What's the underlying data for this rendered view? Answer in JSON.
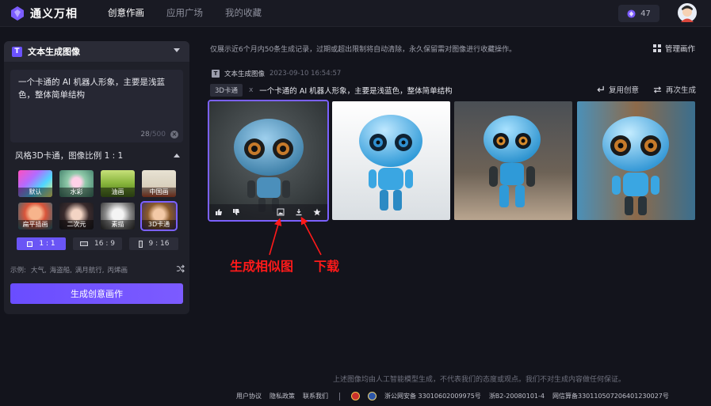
{
  "app": {
    "name": "通义万相",
    "points": "47"
  },
  "nav": {
    "items": [
      {
        "label": "创意作画",
        "active": true
      },
      {
        "label": "应用广场",
        "active": false
      },
      {
        "label": "我的收藏",
        "active": false
      }
    ]
  },
  "panel": {
    "title": "文本生成图像",
    "prompt": "一个卡通的 AI 机器人形象，主要是浅蓝色，整体简单结构",
    "char_count": "28",
    "char_max": "/500",
    "style_summary": "风格3D卡通，图像比例 1 : 1",
    "styles": [
      {
        "label": "默认",
        "selected": false
      },
      {
        "label": "水彩",
        "selected": false
      },
      {
        "label": "油画",
        "selected": false
      },
      {
        "label": "中国画",
        "selected": false
      },
      {
        "label": "扁平插画",
        "selected": false
      },
      {
        "label": "二次元",
        "selected": false
      },
      {
        "label": "素描",
        "selected": false
      },
      {
        "label": "3D卡通",
        "selected": true
      }
    ],
    "ratios": [
      {
        "label": "1 : 1",
        "active": true
      },
      {
        "label": "16 : 9",
        "active": false
      },
      {
        "label": "9 : 16",
        "active": false
      }
    ],
    "examples_label": "示例:",
    "examples": [
      "大气,",
      "海盗船,",
      "满月航行,",
      "丙烯画"
    ],
    "generate_label": "生成创意画作"
  },
  "main": {
    "notice": "仅展示近6个月内50条生成记录，过期或超出限制将自动清除，永久保留需对图像进行收藏操作。",
    "manage_label": "管理画作",
    "record": {
      "kind": "文本生成图像",
      "time": "2023-09-10 16:54:57",
      "tag": "3D卡通",
      "x": "x",
      "prompt": "一个卡通的 AI 机器人形象，主要是浅蓝色，整体简单结构",
      "reuse_label": "复用创意",
      "regen_label": "再次生成"
    }
  },
  "annotations": {
    "similar": "生成相似图",
    "download": "下载"
  },
  "footer": {
    "disclaimer": "上述图像均由人工智能模型生成，不代表我们的态度或观点。我们不对生成内容做任何保证。",
    "links": [
      "用户协议",
      "隐私政策",
      "联系我们"
    ],
    "police_record": "浙公网安备 33010602009975号",
    "icp": "浙B2-20080101-4",
    "algo_record": "网信算备330110507206401230027号"
  }
}
